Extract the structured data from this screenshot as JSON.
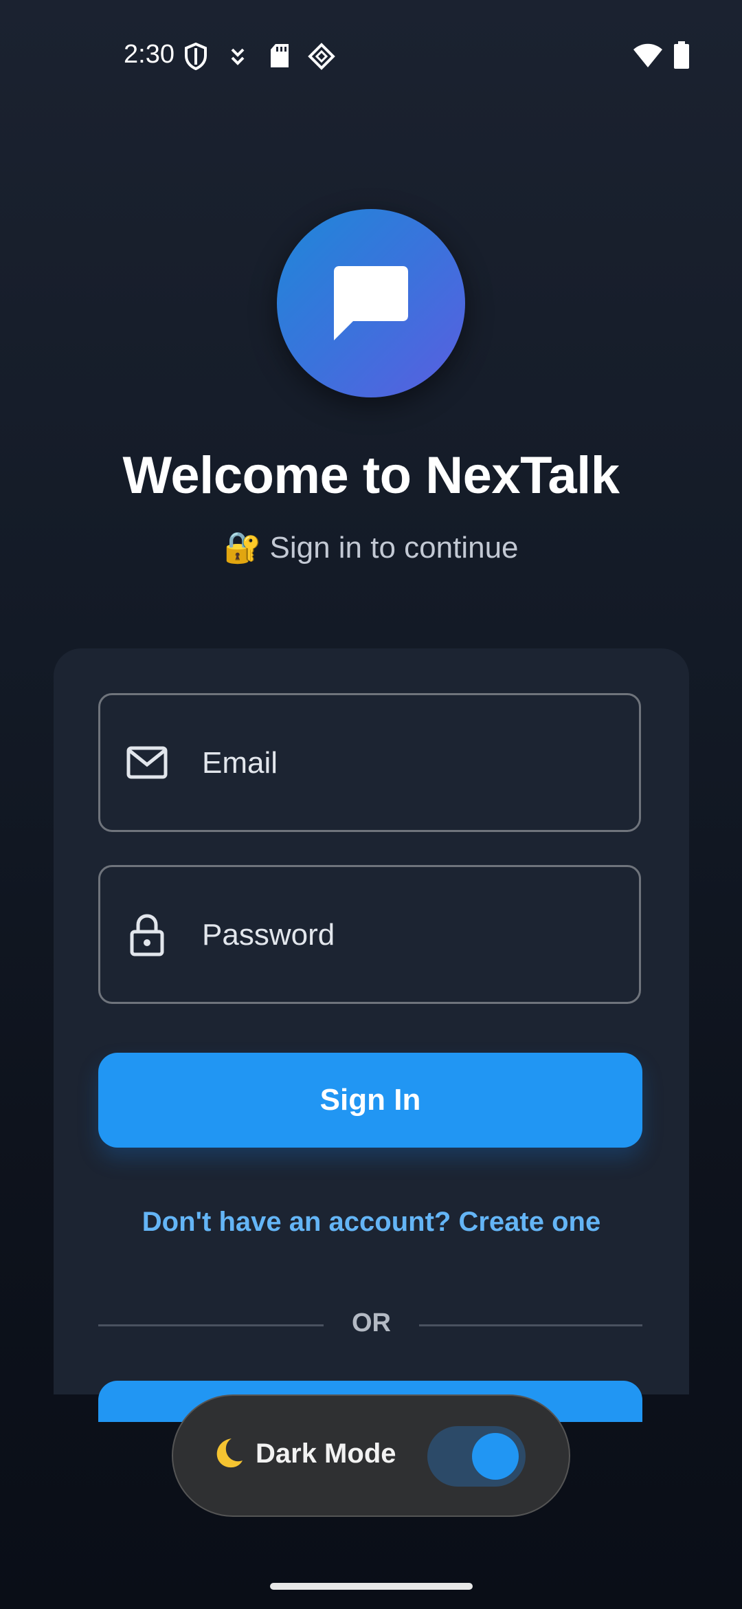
{
  "status_bar": {
    "time": "2:30",
    "left_icons": [
      "shield-icon",
      "download-icon",
      "sd-card-icon",
      "diamond-app-icon"
    ],
    "right_icons": [
      "wifi-icon",
      "battery-icon"
    ]
  },
  "header": {
    "logo_icon": "chat-bubble-icon",
    "title": "Welcome to NexTalk",
    "subtitle": "🔐 Sign in to continue"
  },
  "form": {
    "email_label": "Email",
    "email_icon": "mail-icon",
    "password_label": "Password",
    "password_icon": "lock-icon",
    "sign_in_label": "Sign In",
    "create_account_link": "Don't have an account? Create one",
    "divider_text": "OR"
  },
  "dark_mode_toggle": {
    "emoji": "🌙",
    "label": "Dark Mode",
    "enabled": true
  },
  "colors": {
    "accent": "#2196f3",
    "link": "#64b5f6",
    "card": "#1c2432",
    "background": "#131a26"
  }
}
